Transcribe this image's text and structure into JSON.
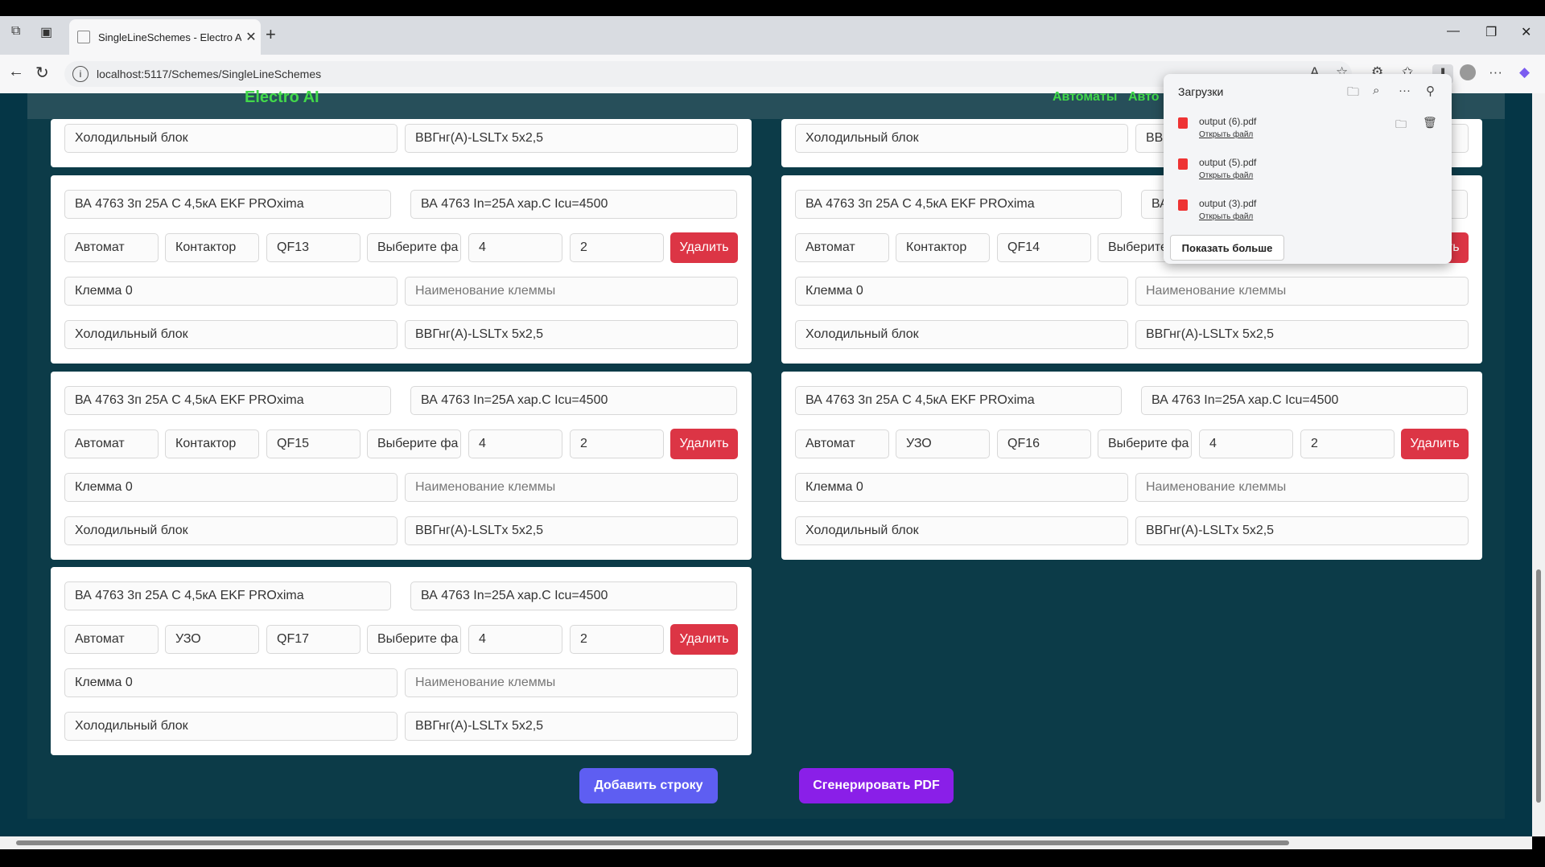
{
  "browser": {
    "tab_title": "SingleLineSchemes - Electro AI",
    "new_tab": "+",
    "url": "localhost:5117/Schemes/SingleLineSchemes"
  },
  "app": {
    "brand": "Electro AI",
    "nav": [
      "Автоматы",
      "Авто"
    ]
  },
  "downloads": {
    "title": "Загрузки",
    "items": [
      {
        "name": "output (6).pdf",
        "action": "Открыть файл"
      },
      {
        "name": "output (5).pdf",
        "action": "Открыть файл"
      },
      {
        "name": "output (3).pdf",
        "action": "Открыть файл"
      }
    ],
    "show_more": "Показать больше"
  },
  "top_row": {
    "left": {
      "block": "Холодильный блок",
      "cable": "ВВГнг(А)-LSLTx 5x2,5"
    },
    "right": {
      "block": "Холодильный блок",
      "cable": "ВВ"
    }
  },
  "cards": [
    {
      "name": "ВА 4763 3п 25А С 4,5кА EKF PROxima",
      "spec": "ВА 4763 In=25A хар.C Icu=4500",
      "type": "Автомат",
      "kind": "Контактор",
      "id": "QF13",
      "phase": "Выберите фа",
      "n1": "4",
      "n2": "2",
      "delete": "Удалить",
      "terminal": "Клемма 0",
      "terminal_ph": "Наименование клеммы",
      "block": "Холодильный блок",
      "cable": "ВВГнг(А)-LSLTx 5x2,5"
    },
    {
      "name": "ВА 4763 3п 25А С 4,5кА EKF PROxima",
      "spec": "ВА",
      "type": "Автомат",
      "kind": "Контактор",
      "id": "QF14",
      "phase": "Выберите",
      "n1": "",
      "n2": "",
      "delete": "Удалить",
      "terminal": "Клемма 0",
      "terminal_ph": "Наименование клеммы",
      "block": "Холодильный блок",
      "cable": "ВВГнг(А)-LSLTx 5x2,5"
    },
    {
      "name": "ВА 4763 3п 25А С 4,5кА EKF PROxima",
      "spec": "ВА 4763 In=25A хар.C Icu=4500",
      "type": "Автомат",
      "kind": "Контактор",
      "id": "QF15",
      "phase": "Выберите фа",
      "n1": "4",
      "n2": "2",
      "delete": "Удалить",
      "terminal": "Клемма 0",
      "terminal_ph": "Наименование клеммы",
      "block": "Холодильный блок",
      "cable": "ВВГнг(А)-LSLTx 5x2,5"
    },
    {
      "name": "ВА 4763 3п 25А С 4,5кА EKF PROxima",
      "spec": "ВА 4763 In=25A хар.C Icu=4500",
      "type": "Автомат",
      "kind": "УЗО",
      "id": "QF16",
      "phase": "Выберите фа",
      "n1": "4",
      "n2": "2",
      "delete": "Удалить",
      "terminal": "Клемма 0",
      "terminal_ph": "Наименование клеммы",
      "block": "Холодильный блок",
      "cable": "ВВГнг(А)-LSLTx 5x2,5"
    },
    {
      "name": "ВА 4763 3п 25А С 4,5кА EKF PROxima",
      "spec": "ВА 4763 In=25A хар.C Icu=4500",
      "type": "Автомат",
      "kind": "УЗО",
      "id": "QF17",
      "phase": "Выберите фа",
      "n1": "4",
      "n2": "2",
      "delete": "Удалить",
      "terminal": "Клемма 0",
      "terminal_ph": "Наименование клеммы",
      "block": "Холодильный блок",
      "cable": "ВВГнг(А)-LSLTx 5x2,5"
    }
  ],
  "actions": {
    "add_row": "Добавить строку",
    "generate_pdf": "Сгенерировать PDF"
  }
}
